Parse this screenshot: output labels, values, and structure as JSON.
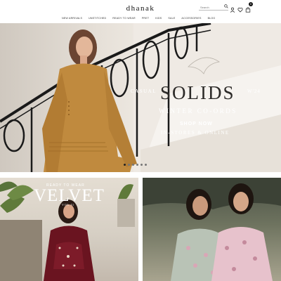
{
  "brand": {
    "logo": "dhanak"
  },
  "search": {
    "placeholder": "Search"
  },
  "cart": {
    "count": "0"
  },
  "nav": {
    "items": [
      "NEW ARRIVALS",
      "UNSTITCHED",
      "READY TO WEAR",
      "PRET",
      "KIDS",
      "SALE",
      "ACCESSORIES",
      "BLOG"
    ]
  },
  "hero": {
    "prefix": "CASUAL",
    "title": "SOLIDS",
    "suffix": "W'24",
    "subtitle": "WINTER CO-ORDS",
    "cta": "SHOP NOW",
    "availability": "IN-STORES & ONLINE",
    "slides": 6,
    "active_slide": 1
  },
  "promo_left": {
    "tagline": "READY TO WEAR",
    "title": "VELVET",
    "volume": "VOL II"
  },
  "colors": {
    "accent": "#111111",
    "dress_mustard": "#c08a3e",
    "velvet": "#6a1420",
    "text_light": "#ffffff"
  }
}
